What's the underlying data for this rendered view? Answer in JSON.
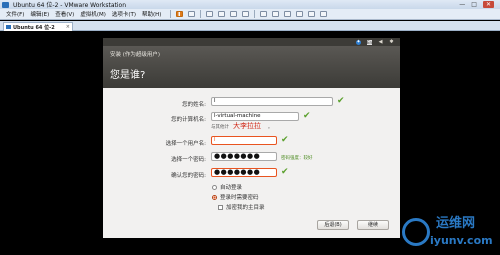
{
  "window": {
    "title": "Ubuntu 64 位-2 - VMware Workstation",
    "controls": [
      "—",
      "□",
      "✕"
    ]
  },
  "menubar": {
    "items": [
      "文件(F)",
      "编辑(E)",
      "查看(V)",
      "虚拟机(M)",
      "选项卡(T)",
      "帮助(H)"
    ]
  },
  "tab": {
    "label": "Ubuntu 64 位-2",
    "close": "×"
  },
  "installer": {
    "window_title": "安装 (作为超级用户)",
    "heading": "您是谁?",
    "panel_icons": [
      "accessibility-icon",
      "keyboard-icon",
      "volume-icon",
      "settings-icon"
    ],
    "panel_text": {
      "kbd": "En"
    },
    "fields": {
      "name_label": "您的姓名:",
      "name_value": "l",
      "computer_label": "您的计算机名:",
      "computer_value": "l-virtual-machine",
      "computer_hint": "与其他计算机联络时使用的名称。",
      "computer_hint_visible": "与其他计",
      "computer_hint_end": "。",
      "annotation": "大李拉拉",
      "username_label": "选择一个用户名:",
      "username_value": "l",
      "password_label": "选择一个密码:",
      "password_value": "●●●●●●●",
      "strength": "密码强度：较好",
      "confirm_label": "确认您的密码:",
      "confirm_value": "●●●●●●●"
    },
    "options": {
      "auto_login": "自动登录",
      "require_password": "登录时需要密码",
      "encrypt_home": "加密我的主目录"
    },
    "buttons": {
      "back": "后退(B)",
      "continue": "继续"
    }
  },
  "watermark": {
    "cn": "运维网",
    "en": "iyunv.com"
  }
}
